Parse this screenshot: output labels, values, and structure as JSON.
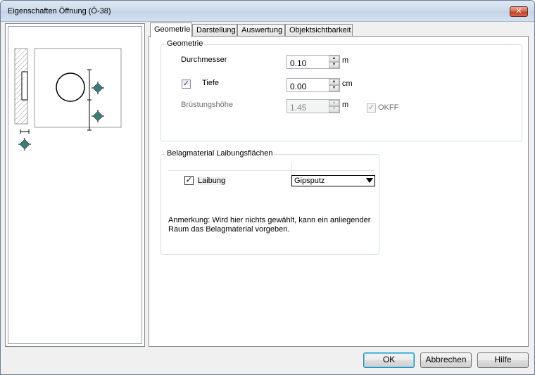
{
  "window": {
    "title": "Eigenschaften Öffnung (Ö-38)",
    "close_label": "✕"
  },
  "tabs": [
    {
      "label": "Geometrie",
      "active": true
    },
    {
      "label": "Darstellung",
      "active": false
    },
    {
      "label": "Auswertung",
      "active": false
    },
    {
      "label": "Objektsichtbarkeit",
      "active": false
    }
  ],
  "geometrie": {
    "legend": "Geometrie",
    "durchmesser": {
      "label": "Durchmesser",
      "value": "0.10",
      "unit": "m"
    },
    "tiefe": {
      "label": "Tiefe",
      "value": "0.00",
      "unit": "cm",
      "checked": true
    },
    "bruestungshoehe": {
      "label": "Brüstungshöhe",
      "value": "1.45",
      "unit": "m",
      "disabled": true
    },
    "okff": {
      "label": "OKFF",
      "checked": true,
      "disabled": true
    }
  },
  "belag": {
    "legend": "Belagmaterial Laibungsflächen",
    "row": {
      "label": "Laibung",
      "checked": true,
      "material": "Gipsputz"
    },
    "note_line1": "Anmerkung:   Wird hier nichts gewählt, kann ein anliegender",
    "note_line2": "Raum das Belagmaterial vorgeben."
  },
  "buttons": {
    "ok": "OK",
    "cancel": "Abbrechen",
    "help": "Hilfe"
  },
  "colors": {
    "marker": "#3c7a76",
    "titlebar": "#cddaea"
  }
}
